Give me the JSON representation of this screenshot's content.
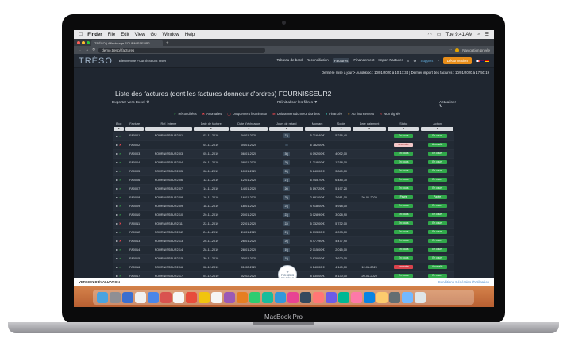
{
  "laptop": {
    "brand": "MacBook Pro"
  },
  "menubar": {
    "apple": "",
    "items": [
      "Finder",
      "File",
      "Edit",
      "View",
      "Go",
      "Window",
      "Help"
    ],
    "clock": "Tue 9:41 AM"
  },
  "browser": {
    "tab_label": "TRÉSO | Affacturage FOURNISSEUR2",
    "url": "demo.treso/ factures",
    "profile": "Navigation privée"
  },
  "app": {
    "logo": "TRÉSO",
    "welcome": "Bienvenue Fournisseur2 User",
    "nav": [
      "Tableau de bord",
      "Réconciliation",
      "Factures",
      "Financement",
      "Import Factures"
    ],
    "active_nav": "Factures",
    "support": "Support",
    "orange_button": "Déconnexion",
    "status_line": "Dernière mise à jour > Autoblooc : 10/01/2020 à 10:17:34 | Dernier import des factures : 10/01/2020 à 17:50:19"
  },
  "page": {
    "title": "Liste des factures (dont les factures donneur d'ordres) FOURNISSEUR2",
    "export_label": "Exporter vers Excel",
    "filter_label": "Réinitialiser les filtres",
    "refresh_label": "Actualiser"
  },
  "legend": [
    {
      "sym": "✔",
      "label": "Réconciliées",
      "color": "#38b54a"
    },
    {
      "sym": "✖",
      "label": "Anomalies",
      "color": "#e2444b"
    },
    {
      "sym": "◯",
      "label": "Uniquement fournisseur",
      "color": "#e2444b"
    },
    {
      "sym": "⇄",
      "label": "Uniquement donneur d'ordres",
      "color": "#e2444b"
    },
    {
      "sym": "●",
      "label": "Financée",
      "color": "#2fb5a8"
    },
    {
      "sym": "●",
      "label": "Au financement",
      "color": "#e59b2a"
    },
    {
      "sym": "✎",
      "label": "Non signée",
      "color": "#e2444b"
    }
  ],
  "table": {
    "columns": [
      "Bloc",
      "Facture",
      "Réf. Interne",
      "Date de facture",
      "Date d'échéance",
      "Jours de retard",
      "Montant",
      "Solde",
      "Date paiement",
      "Statut",
      "Action"
    ],
    "rows": [
      {
        "icon": "chk",
        "facture": "FA0001",
        "ref": "FOURNISSEUR2-01",
        "date": "02-11-2019",
        "due": "04-01-2020",
        "days": "32j",
        "tagc": "",
        "amount": "5 216,40 €",
        "solde": "5 216,40",
        "paid": "",
        "status": "En cours",
        "stc": "st-green"
      },
      {
        "icon": "cross",
        "facture": "FA0002",
        "ref": "",
        "date": "04-11-2019",
        "due": "04-01-2020",
        "days": "",
        "tagc": "",
        "amount": "6 782,00 €",
        "solde": "",
        "paid": "",
        "status": "Anomalie",
        "stc": "st-pink"
      },
      {
        "icon": "chk",
        "facture": "FA0003",
        "ref": "FOURNISSEUR2-03",
        "date": "05-11-2019",
        "due": "06-01-2020",
        "days": "30j",
        "tagc": "",
        "amount": "4 092,00 €",
        "solde": "4 092,00",
        "paid": "",
        "status": "En cours",
        "stc": "st-green"
      },
      {
        "icon": "chk",
        "facture": "FA0004",
        "ref": "FOURNISSEUR2-04",
        "date": "06-11-2019",
        "due": "08-01-2020",
        "days": "29j",
        "tagc": "",
        "amount": "1 218,00 €",
        "solde": "1 218,00",
        "paid": "",
        "status": "En cours",
        "stc": "st-green"
      },
      {
        "icon": "chk",
        "facture": "FA0005",
        "ref": "FOURNISSEUR2-05",
        "date": "08-11-2019",
        "due": "10-01-2020",
        "days": "28j",
        "tagc": "",
        "amount": "3 840,00 €",
        "solde": "3 840,00",
        "paid": "",
        "status": "En cours",
        "stc": "st-green"
      },
      {
        "icon": "chk",
        "facture": "FA0006",
        "ref": "FOURNISSEUR2-06",
        "date": "12-11-2019",
        "due": "12-01-2020",
        "days": "27j",
        "tagc": "",
        "amount": "6 445,70 €",
        "solde": "6 445,70",
        "paid": "",
        "status": "En cours",
        "stc": "st-green"
      },
      {
        "icon": "chk",
        "facture": "FA0007",
        "ref": "FOURNISSEUR2-07",
        "date": "14-11-2019",
        "due": "14-01-2020",
        "days": "26j",
        "tagc": "",
        "amount": "5 197,20 €",
        "solde": "5 197,20",
        "paid": "",
        "status": "En cours",
        "stc": "st-green"
      },
      {
        "icon": "chk",
        "facture": "FA0008",
        "ref": "FOURNISSEUR2-08",
        "date": "16-11-2019",
        "due": "16-01-2020",
        "days": "25j",
        "tagc": "",
        "amount": "2 681,00 €",
        "solde": "2 681,00",
        "paid": "20-01-2020",
        "status": "Payée",
        "stc": "st-green"
      },
      {
        "icon": "chk",
        "facture": "FA0009",
        "ref": "FOURNISSEUR2-09",
        "date": "18-11-2019",
        "due": "18-01-2020",
        "days": "24j",
        "tagc": "",
        "amount": "4 918,00 €",
        "solde": "4 918,00",
        "paid": "",
        "status": "En cours",
        "stc": "st-green"
      },
      {
        "icon": "chk",
        "facture": "FA0010",
        "ref": "FOURNISSEUR2-10",
        "date": "20-11-2019",
        "due": "20-01-2020",
        "days": "23j",
        "tagc": "",
        "amount": "3 028,90 €",
        "solde": "3 028,90",
        "paid": "",
        "status": "En cours",
        "stc": "st-green"
      },
      {
        "icon": "cross",
        "facture": "FA0011",
        "ref": "FOURNISSEUR2-11",
        "date": "22-11-2019",
        "due": "22-01-2020",
        "days": "22j",
        "tagc": "",
        "amount": "5 732,00 €",
        "solde": "5 732,00",
        "paid": "",
        "status": "En cours",
        "stc": "st-green"
      },
      {
        "icon": "chk",
        "facture": "FA0012",
        "ref": "FOURNISSEUR2-12",
        "date": "24-11-2019",
        "due": "24-01-2020",
        "days": "21j",
        "tagc": "",
        "amount": "6 093,00 €",
        "solde": "6 093,00",
        "paid": "",
        "status": "En cours",
        "stc": "st-green"
      },
      {
        "icon": "cross",
        "facture": "FA0013",
        "ref": "FOURNISSEUR2-13",
        "date": "26-11-2019",
        "due": "26-01-2020",
        "days": "20j",
        "tagc": "",
        "amount": "4 477,90 €",
        "solde": "4 477,90",
        "paid": "",
        "status": "En cours",
        "stc": "st-green"
      },
      {
        "icon": "chk",
        "facture": "FA0014",
        "ref": "FOURNISSEUR2-14",
        "date": "28-11-2019",
        "due": "28-01-2020",
        "days": "19j",
        "tagc": "",
        "amount": "2 015,00 €",
        "solde": "2 015,00",
        "paid": "",
        "status": "En cours",
        "stc": "st-green"
      },
      {
        "icon": "chk",
        "facture": "FA0015",
        "ref": "FOURNISSEUR2-15",
        "date": "30-11-2019",
        "due": "30-01-2020",
        "days": "18j",
        "tagc": "",
        "amount": "3 620,00 €",
        "solde": "3 620,00",
        "paid": "",
        "status": "En cours",
        "stc": "st-green"
      },
      {
        "icon": "chk",
        "facture": "FA0016",
        "ref": "FOURNISSEUR2-16",
        "date": "02-12-2019",
        "due": "01-02-2020",
        "days": "17j",
        "tagc": "",
        "amount": "4 140,00 €",
        "solde": "4 140,00",
        "paid": "12-01-2020",
        "status": "Anomalie",
        "stc": "st-red"
      },
      {
        "icon": "chk",
        "facture": "FA0017",
        "ref": "FOURNISSEUR2-17",
        "date": "04-12-2019",
        "due": "02-02-2020",
        "days": "16j",
        "tagc": "red",
        "amount": "8 130,00 €",
        "solde": "8 130,00",
        "paid": "20-01-2020",
        "status": "En cours",
        "stc": "st-green"
      }
    ]
  },
  "footer": {
    "eval": "VERSION D'ÉVALUATION",
    "conditions": "Conditions Générales d'Utilisation",
    "badge": "FICHIERS DE DÉMO"
  },
  "dock": {
    "colors": [
      "#4aa3df",
      "#8f8f94",
      "#3b6fd0",
      "#f0f0f0",
      "#4a86e8",
      "#d9534f",
      "#f6f6f6",
      "#e74c3c",
      "#f1c40f",
      "#f5f5f5",
      "#9b59b6",
      "#e67e22",
      "#2ecc71",
      "#1abc9c",
      "#3498db",
      "#e84393",
      "#34495e",
      "#ff7675",
      "#6c5ce7",
      "#00b894",
      "#fd79a8",
      "#0984e3",
      "#fdcb6e",
      "#636e72",
      "#74b9ff",
      "#dfe6e9"
    ]
  },
  "colors": {
    "accent_orange": "#e88e1a",
    "status_green": "#31a84a",
    "status_red": "#d9434c",
    "bg": "#1f2630"
  }
}
